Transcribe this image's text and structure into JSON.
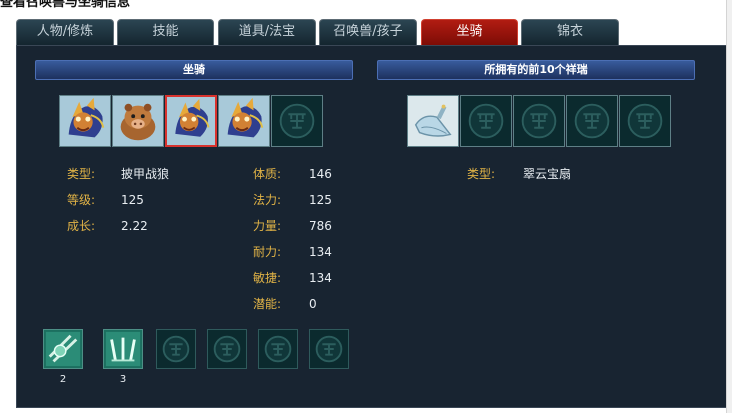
{
  "page": {
    "clipped_heading": "查看召唤兽与坐骑信息"
  },
  "tabs": [
    {
      "label": "人物/修炼"
    },
    {
      "label": "技能"
    },
    {
      "label": "道具/法宝"
    },
    {
      "label": "召唤兽/孩子"
    },
    {
      "label": "坐骑"
    },
    {
      "label": "锦衣"
    }
  ],
  "mount_section": {
    "title": "坐骑",
    "slots": [
      "dragon-mount-icon",
      "boar-mount-icon",
      "dragon-mount-icon",
      "dragon-mount-icon",
      "empty-slot-icon"
    ],
    "selected_index": 2,
    "info": {
      "type_label": "类型:",
      "type_value": "披甲战狼",
      "level_label": "等级:",
      "level_value": "125",
      "growth_label": "成长:",
      "growth_value": "2.22"
    },
    "stats": {
      "constitution_label": "体质:",
      "constitution_value": "146",
      "magic_label": "法力:",
      "magic_value": "125",
      "strength_label": "力量:",
      "strength_value": "786",
      "endurance_label": "耐力:",
      "endurance_value": "134",
      "agility_label": "敏捷:",
      "agility_value": "134",
      "potential_label": "潜能:",
      "potential_value": "0"
    },
    "skills": [
      {
        "icon": "slash-skill-icon",
        "level": "2"
      },
      {
        "icon": "claw-skill-icon",
        "level": "3"
      },
      {
        "icon": "empty-slot-icon",
        "level": ""
      },
      {
        "icon": "empty-slot-icon",
        "level": ""
      },
      {
        "icon": "empty-slot-icon",
        "level": ""
      },
      {
        "icon": "empty-slot-icon",
        "level": ""
      }
    ]
  },
  "xiangrui_section": {
    "title": "所拥有的前10个祥瑞",
    "slots": [
      "fan-icon",
      "empty-slot-icon",
      "empty-slot-icon",
      "empty-slot-icon",
      "empty-slot-icon"
    ],
    "type_label": "类型:",
    "type_value": "翠云宝扇"
  },
  "colors": {
    "panel_bg": "#182431",
    "active_tab": "#a8170f",
    "label_gold": "#e1b346",
    "header_blue": "#2b4a84"
  }
}
